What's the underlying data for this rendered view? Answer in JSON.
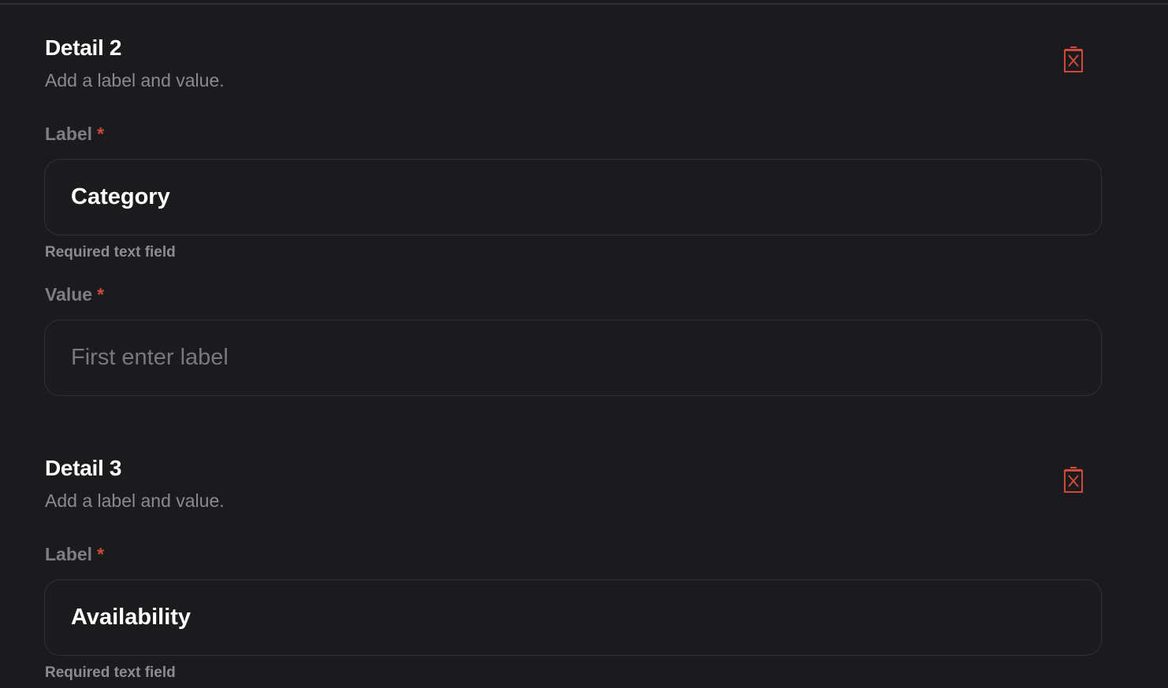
{
  "details": [
    {
      "title": "Detail 2",
      "subtitle": "Add a label and value.",
      "label_field": {
        "label": "Label",
        "required_mark": "*",
        "value": "Category",
        "helper": "Required text field"
      },
      "value_field": {
        "label": "Value",
        "required_mark": "*",
        "value": "",
        "placeholder": "First enter label"
      },
      "delete_icon": "trash-x-icon"
    },
    {
      "title": "Detail 3",
      "subtitle": "Add a label and value.",
      "label_field": {
        "label": "Label",
        "required_mark": "*",
        "value": "Availability",
        "helper": "Required text field"
      },
      "delete_icon": "trash-x-icon"
    }
  ],
  "colors": {
    "background": "#1b1b1d",
    "danger": "#cf4a3c",
    "muted_text": "#8a8a8f",
    "input_border": "#303034"
  }
}
